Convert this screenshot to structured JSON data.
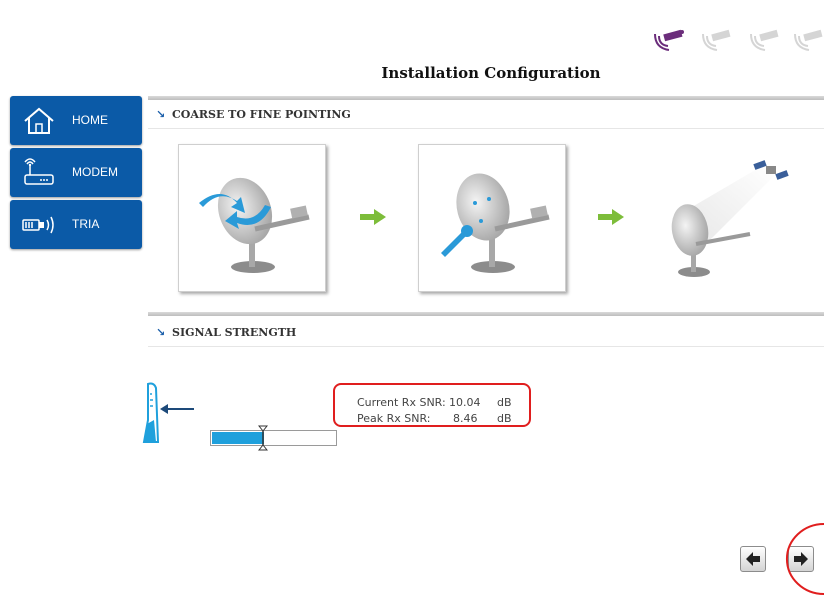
{
  "header": {
    "title": "Installation Configuration",
    "steps": [
      {
        "name": "step-1",
        "active": true
      },
      {
        "name": "step-2",
        "active": false
      },
      {
        "name": "step-3",
        "active": false
      },
      {
        "name": "step-4",
        "active": false
      }
    ]
  },
  "nav": {
    "items": [
      {
        "label": "HOME",
        "icon": "home-icon"
      },
      {
        "label": "MODEM",
        "icon": "modem-icon"
      },
      {
        "label": "TRIA",
        "icon": "tria-icon"
      }
    ]
  },
  "pointing": {
    "title": "COARSE TO FINE POINTING",
    "images": [
      "coarse-pointing-image",
      "fine-pointing-image",
      "satellite-aligned-image"
    ]
  },
  "signal": {
    "title": "SIGNAL STRENGTH",
    "current_label": "Current Rx SNR:",
    "current_value": "10.04",
    "current_unit": "dB",
    "peak_label": "Peak Rx SNR:",
    "peak_value": "8.46",
    "peak_unit": "dB",
    "level_fraction": 0.42,
    "peak_fraction": 0.42
  },
  "footer": {
    "back_icon": "arrow-left-icon",
    "next_icon": "arrow-right-icon"
  },
  "colors": {
    "nav_blue": "#0b5aa7",
    "active_step": "#6b2d7b",
    "inactive_step": "#d5d5d5",
    "signal_fill": "#1fa0dc",
    "highlight_red": "#e01e1e",
    "green_arrow": "#7dbd3a"
  }
}
